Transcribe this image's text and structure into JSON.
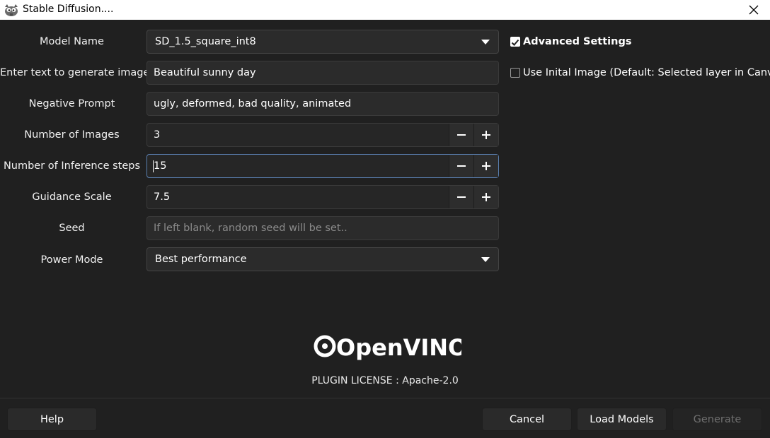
{
  "window": {
    "title": "Stable Diffusion...."
  },
  "form": {
    "model_name": {
      "label": "Model Name",
      "value": "SD_1.5_square_int8"
    },
    "prompt": {
      "label": "Enter text to generate image",
      "value": "Beautiful sunny day"
    },
    "negative_prompt": {
      "label": "Negative Prompt",
      "value": "ugly, deformed, bad quality, animated"
    },
    "num_images": {
      "label": "Number of Images",
      "value": "3"
    },
    "inference_steps": {
      "label": "Number of Inference steps",
      "value": "15"
    },
    "guidance_scale": {
      "label": "Guidance Scale",
      "value": "7.5"
    },
    "seed": {
      "label": "Seed",
      "value": "",
      "placeholder": "If left blank, random seed will be set.."
    },
    "power_mode": {
      "label": "Power Mode",
      "value": "Best performance"
    }
  },
  "options": {
    "advanced_settings": {
      "label": "Advanced Settings",
      "checked": true
    },
    "initial_image": {
      "label": "Use Inital Image (Default: Selected layer in Canvas)",
      "checked": false
    }
  },
  "branding": {
    "logo_text": "OpenVINO",
    "license": "PLUGIN LICENSE : Apache-2.0"
  },
  "buttons": {
    "help": "Help",
    "cancel": "Cancel",
    "load_models": "Load Models",
    "generate": "Generate"
  },
  "colors": {
    "background": "#202020",
    "field": "#2b2b2b",
    "focus": "#5a7fb0",
    "disabled_text": "#6f6f6f"
  }
}
